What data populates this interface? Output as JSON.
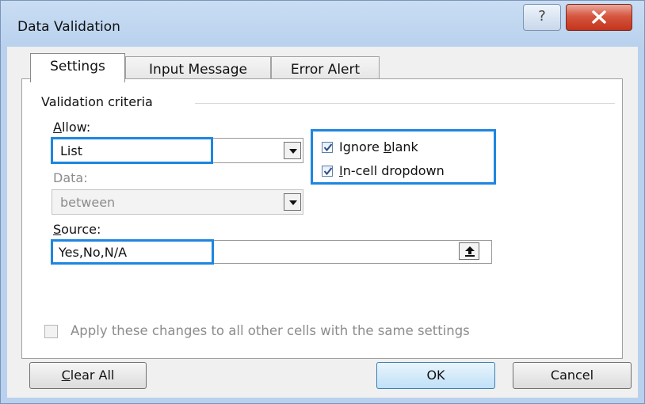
{
  "window": {
    "title": "Data Validation",
    "help_glyph": "?"
  },
  "tabs": [
    {
      "label": "Settings",
      "active": true
    },
    {
      "label": "Input Message",
      "active": false
    },
    {
      "label": "Error Alert",
      "active": false
    }
  ],
  "criteria": {
    "group_label": "Validation criteria",
    "allow_label_key": "A",
    "allow_label_rest": "llow:",
    "allow_value": "List",
    "data_label": "Data:",
    "data_value": "between",
    "data_enabled": false,
    "source_label_key": "S",
    "source_label_rest": "ource:",
    "source_value": "Yes,No,N/A"
  },
  "options": {
    "ignore_blank_pre": "Ignore ",
    "ignore_blank_key": "b",
    "ignore_blank_post": "lank",
    "ignore_blank_checked": true,
    "incell_key": "I",
    "incell_rest": "n-cell dropdown",
    "incell_checked": true
  },
  "apply_all": {
    "label": "Apply these changes to all other cells with the same settings",
    "checked": false,
    "enabled": false
  },
  "buttons": {
    "clear_all_key": "C",
    "clear_all_rest": "lear All",
    "ok": "OK",
    "cancel": "Cancel"
  },
  "colors": {
    "highlight": "#1e86e0",
    "title_bar": "#b9d1ee",
    "close_button": "#c3341c"
  }
}
